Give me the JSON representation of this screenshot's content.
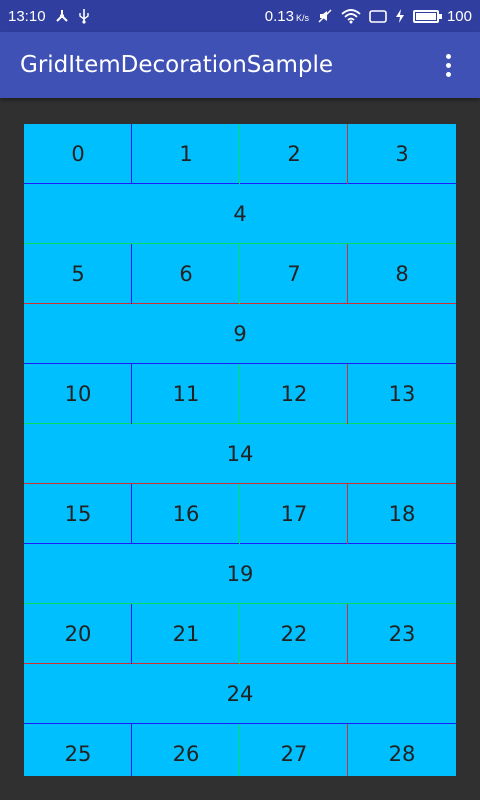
{
  "status_bar": {
    "time": "13:10",
    "speed": "0.13",
    "speed_unit": "K/s",
    "battery_level": "100",
    "icons": [
      "share-icon",
      "usb-icon",
      "mute-icon",
      "wifi-icon",
      "screen-icon",
      "charging-icon",
      "battery-icon"
    ]
  },
  "app_bar": {
    "title": "GridItemDecorationSample",
    "menu_icon": "more-vert-icon"
  },
  "colors": {
    "status_bar": "#303F9F",
    "app_bar": "#3F51B5",
    "background": "#303030",
    "item": "#00BFFF",
    "divider_blue": "#1a1aff",
    "divider_green": "#00e060",
    "divider_red": "#d03030"
  },
  "grid": {
    "rows": [
      {
        "items": [
          "0",
          "1",
          "2",
          "3"
        ],
        "col_colors": [
          "blue",
          "green",
          "red"
        ]
      },
      {
        "items": [
          "4"
        ]
      },
      {
        "items": [
          "5",
          "6",
          "7",
          "8"
        ],
        "col_colors": [
          "blue",
          "green",
          "red"
        ]
      },
      {
        "items": [
          "9"
        ]
      },
      {
        "items": [
          "10",
          "11",
          "12",
          "13"
        ],
        "col_colors": [
          "blue",
          "green",
          "red"
        ]
      },
      {
        "items": [
          "14"
        ]
      },
      {
        "items": [
          "15",
          "16",
          "17",
          "18"
        ],
        "col_colors": [
          "blue",
          "green",
          "red"
        ]
      },
      {
        "items": [
          "19"
        ]
      },
      {
        "items": [
          "20",
          "21",
          "22",
          "23"
        ],
        "col_colors": [
          "blue",
          "green",
          "red"
        ]
      },
      {
        "items": [
          "24"
        ]
      },
      {
        "items": [
          "25",
          "26",
          "27",
          "28"
        ],
        "col_colors": [
          "blue",
          "green",
          "red"
        ]
      }
    ],
    "row_separator_colors": [
      "blue",
      "green",
      "red",
      "blue",
      "green",
      "red",
      "blue",
      "green",
      "red",
      "blue"
    ]
  }
}
